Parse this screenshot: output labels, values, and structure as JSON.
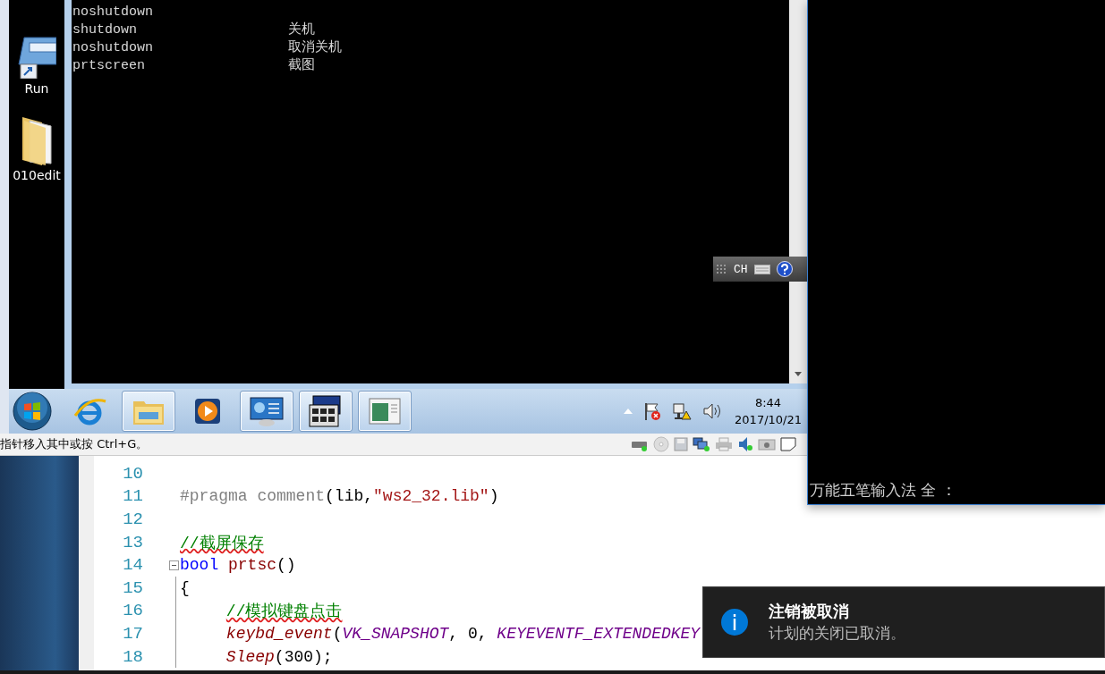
{
  "desktop_icons": [
    {
      "label": "Run",
      "kind": "shortcut"
    },
    {
      "label": "010edit",
      "kind": "folder"
    }
  ],
  "console": {
    "lines": [
      {
        "command": "noshutdown"
      },
      {
        "command": "shutdown",
        "description": "关机"
      },
      {
        "command": "noshutdown",
        "description": "取消关机"
      },
      {
        "command": "prtscreen",
        "description": "截图"
      }
    ]
  },
  "ime_bar": {
    "language": "CH"
  },
  "taskbar": {
    "apps": [
      {
        "kind": "browser",
        "running": false
      },
      {
        "kind": "explorer",
        "running": true
      },
      {
        "kind": "media",
        "running": false
      },
      {
        "kind": "control",
        "running": true
      },
      {
        "kind": "cmd",
        "running": true
      },
      {
        "kind": "window",
        "running": true
      }
    ],
    "clock": {
      "time": "8:44",
      "date": "2017/10/21"
    }
  },
  "vm_status_bar": {
    "hint": "指针移入其中或按 Ctrl+G。"
  },
  "editor": {
    "lines": [
      {
        "number": "10",
        "kind": "plain"
      },
      {
        "number": "11",
        "kind": "plain",
        "tokens": [
          {
            "kind": "pre",
            "text": "#pragma comment"
          },
          {
            "kind": "plain",
            "text": "(lib,"
          },
          {
            "kind": "string",
            "text": "\"ws2_32.lib\""
          },
          {
            "kind": "plain",
            "text": ")"
          }
        ]
      },
      {
        "number": "12",
        "kind": "plain"
      },
      {
        "number": "13",
        "kind": "plain",
        "tokens": [
          {
            "kind": "comment",
            "text": "//截屏保存"
          }
        ]
      },
      {
        "number": "14",
        "kind": "fold",
        "tokens": [
          {
            "kind": "keyword",
            "text": "bool"
          },
          {
            "kind": "function",
            "text": "prtsc"
          },
          {
            "kind": "plain",
            "text": "()"
          }
        ]
      },
      {
        "number": "15",
        "kind": "guide",
        "tokens": [
          {
            "kind": "plain",
            "text": "{"
          }
        ]
      },
      {
        "number": "16",
        "kind": "guide",
        "indented": true,
        "tokens": [
          {
            "kind": "comment",
            "text": "//模拟键盘点击"
          }
        ]
      },
      {
        "number": "17",
        "kind": "guide",
        "indented": true,
        "tokens": [
          {
            "kind": "call",
            "text": "keybd_event"
          },
          {
            "kind": "plain",
            "text": "("
          },
          {
            "kind": "macro",
            "text": "VK_SNAPSHOT"
          },
          {
            "kind": "plain",
            "text": ", 0, "
          },
          {
            "kind": "macro",
            "text": "KEYEVENTF_EXTENDEDKEY"
          }
        ]
      },
      {
        "number": "18",
        "kind": "guide",
        "indented": true,
        "tokens": [
          {
            "kind": "call",
            "text": "Sleep"
          },
          {
            "kind": "plain",
            "text": "(300);"
          }
        ]
      }
    ]
  },
  "ime_console": {
    "status": "万能五笔输入法 全 ："
  },
  "toast": {
    "title": "注销被取消",
    "message": "计划的关闭已取消。"
  }
}
